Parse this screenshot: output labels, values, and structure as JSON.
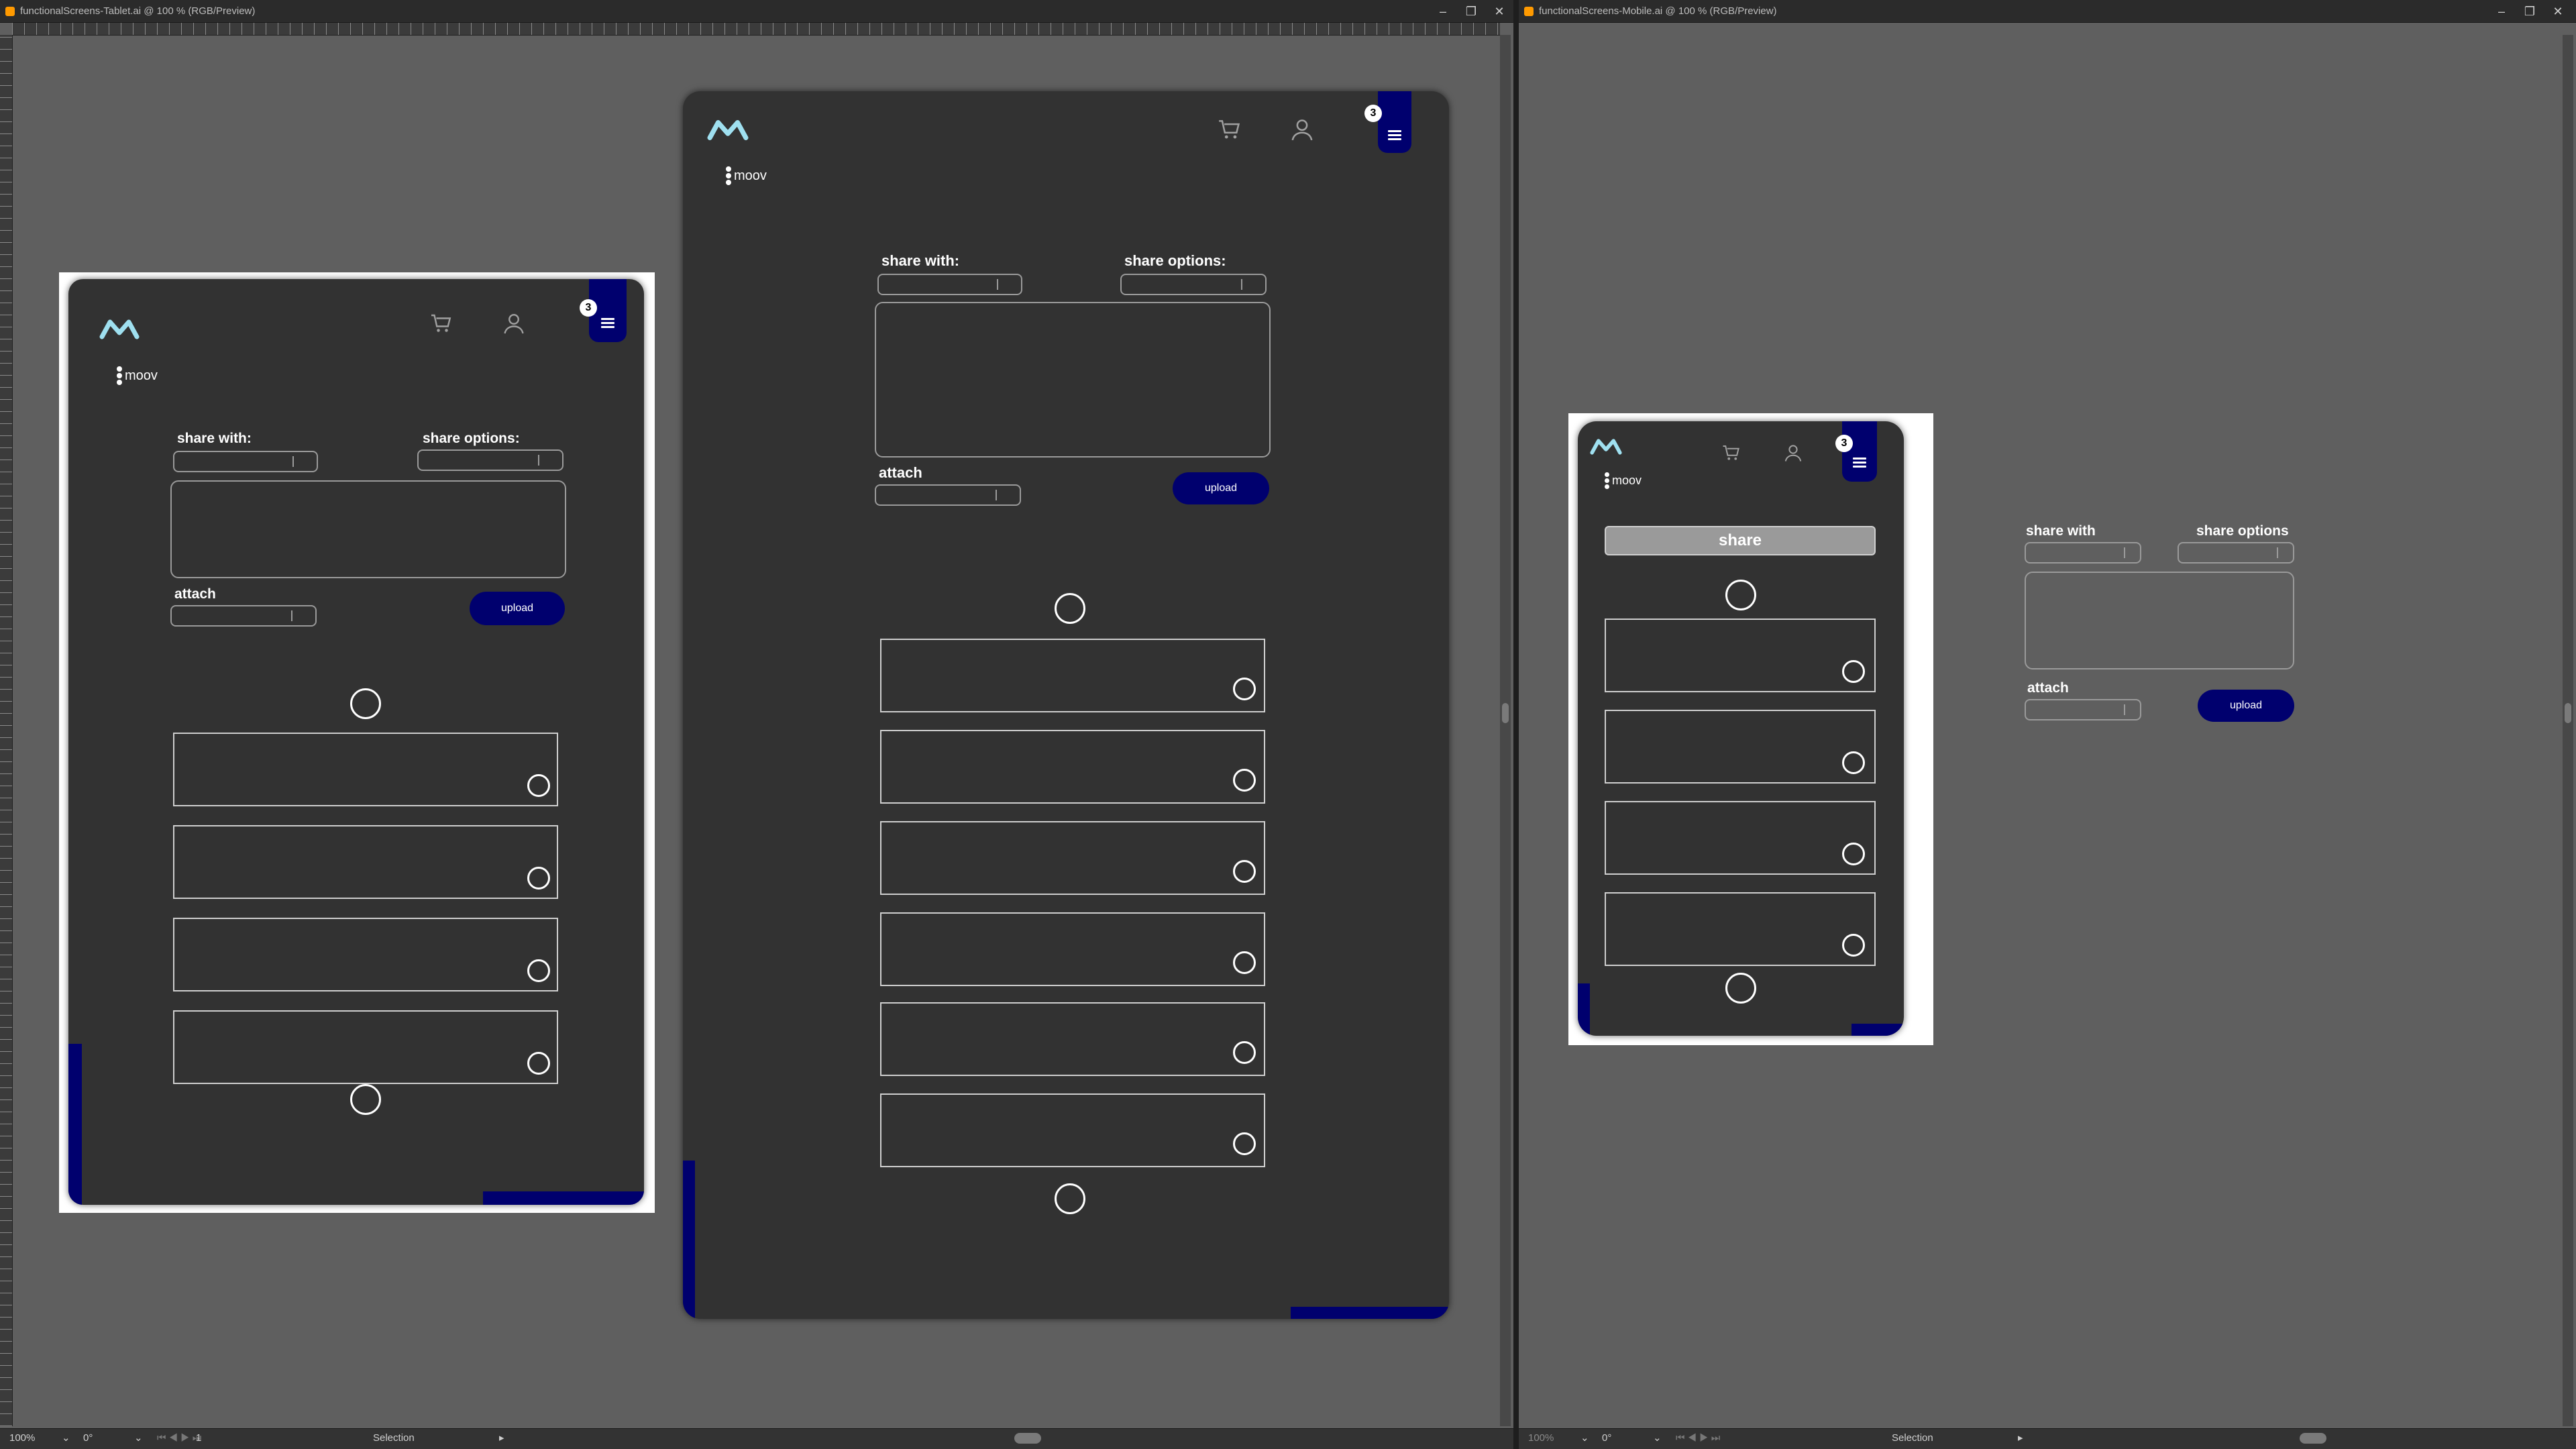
{
  "windows": {
    "tablet": {
      "title": "functionalScreens-Tablet.ai @ 100 % (RGB/Preview)"
    },
    "mobile": {
      "title": "functionalScreens-Mobile.ai @ 100 % (RGB/Preview)"
    }
  },
  "window_controls": {
    "minimize": "–",
    "restore": "❐",
    "close": "✕"
  },
  "statusbar": {
    "zoom": "100%",
    "rotation": "0°",
    "artboard_number": "1",
    "tool": "Selection",
    "nav_arrows": "⏮ ◀ ▶ ⏭"
  },
  "brand": {
    "name": "moov",
    "logo_icon": "mountain-m-logo"
  },
  "header": {
    "cart_icon": "cart-icon",
    "user_icon": "user-icon",
    "menu_icon": "hamburger-icon",
    "notification_count": "3"
  },
  "form": {
    "share_with_label": "share with:",
    "share_options_label": "share options:",
    "attach_label": "attach",
    "upload_label": "upload"
  },
  "mobile_form": {
    "share_label": "share",
    "share_with_label": "share with",
    "share_options_label": "share options",
    "attach_label": "attach",
    "upload_label": "upload"
  },
  "colors": {
    "accent": "#00006e",
    "screen_bg": "#323232",
    "canvas_bg": "#5f5f5f"
  }
}
